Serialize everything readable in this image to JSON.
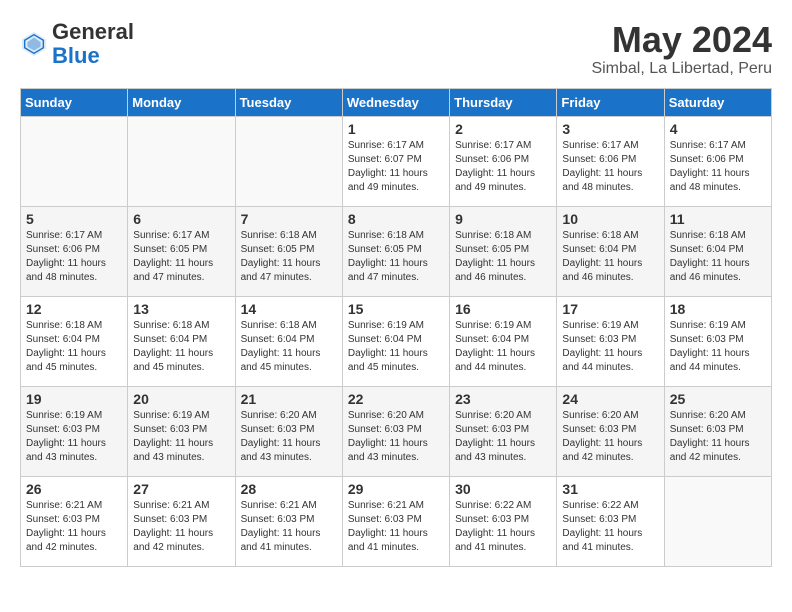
{
  "logo": {
    "general": "General",
    "blue": "Blue"
  },
  "title": {
    "month_year": "May 2024",
    "location": "Simbal, La Libertad, Peru"
  },
  "days_of_week": [
    "Sunday",
    "Monday",
    "Tuesday",
    "Wednesday",
    "Thursday",
    "Friday",
    "Saturday"
  ],
  "weeks": [
    [
      {
        "day": "",
        "info": ""
      },
      {
        "day": "",
        "info": ""
      },
      {
        "day": "",
        "info": ""
      },
      {
        "day": "1",
        "info": "Sunrise: 6:17 AM\nSunset: 6:07 PM\nDaylight: 11 hours\nand 49 minutes."
      },
      {
        "day": "2",
        "info": "Sunrise: 6:17 AM\nSunset: 6:06 PM\nDaylight: 11 hours\nand 49 minutes."
      },
      {
        "day": "3",
        "info": "Sunrise: 6:17 AM\nSunset: 6:06 PM\nDaylight: 11 hours\nand 48 minutes."
      },
      {
        "day": "4",
        "info": "Sunrise: 6:17 AM\nSunset: 6:06 PM\nDaylight: 11 hours\nand 48 minutes."
      }
    ],
    [
      {
        "day": "5",
        "info": "Sunrise: 6:17 AM\nSunset: 6:06 PM\nDaylight: 11 hours\nand 48 minutes."
      },
      {
        "day": "6",
        "info": "Sunrise: 6:17 AM\nSunset: 6:05 PM\nDaylight: 11 hours\nand 47 minutes."
      },
      {
        "day": "7",
        "info": "Sunrise: 6:18 AM\nSunset: 6:05 PM\nDaylight: 11 hours\nand 47 minutes."
      },
      {
        "day": "8",
        "info": "Sunrise: 6:18 AM\nSunset: 6:05 PM\nDaylight: 11 hours\nand 47 minutes."
      },
      {
        "day": "9",
        "info": "Sunrise: 6:18 AM\nSunset: 6:05 PM\nDaylight: 11 hours\nand 46 minutes."
      },
      {
        "day": "10",
        "info": "Sunrise: 6:18 AM\nSunset: 6:04 PM\nDaylight: 11 hours\nand 46 minutes."
      },
      {
        "day": "11",
        "info": "Sunrise: 6:18 AM\nSunset: 6:04 PM\nDaylight: 11 hours\nand 46 minutes."
      }
    ],
    [
      {
        "day": "12",
        "info": "Sunrise: 6:18 AM\nSunset: 6:04 PM\nDaylight: 11 hours\nand 45 minutes."
      },
      {
        "day": "13",
        "info": "Sunrise: 6:18 AM\nSunset: 6:04 PM\nDaylight: 11 hours\nand 45 minutes."
      },
      {
        "day": "14",
        "info": "Sunrise: 6:18 AM\nSunset: 6:04 PM\nDaylight: 11 hours\nand 45 minutes."
      },
      {
        "day": "15",
        "info": "Sunrise: 6:19 AM\nSunset: 6:04 PM\nDaylight: 11 hours\nand 45 minutes."
      },
      {
        "day": "16",
        "info": "Sunrise: 6:19 AM\nSunset: 6:04 PM\nDaylight: 11 hours\nand 44 minutes."
      },
      {
        "day": "17",
        "info": "Sunrise: 6:19 AM\nSunset: 6:03 PM\nDaylight: 11 hours\nand 44 minutes."
      },
      {
        "day": "18",
        "info": "Sunrise: 6:19 AM\nSunset: 6:03 PM\nDaylight: 11 hours\nand 44 minutes."
      }
    ],
    [
      {
        "day": "19",
        "info": "Sunrise: 6:19 AM\nSunset: 6:03 PM\nDaylight: 11 hours\nand 43 minutes."
      },
      {
        "day": "20",
        "info": "Sunrise: 6:19 AM\nSunset: 6:03 PM\nDaylight: 11 hours\nand 43 minutes."
      },
      {
        "day": "21",
        "info": "Sunrise: 6:20 AM\nSunset: 6:03 PM\nDaylight: 11 hours\nand 43 minutes."
      },
      {
        "day": "22",
        "info": "Sunrise: 6:20 AM\nSunset: 6:03 PM\nDaylight: 11 hours\nand 43 minutes."
      },
      {
        "day": "23",
        "info": "Sunrise: 6:20 AM\nSunset: 6:03 PM\nDaylight: 11 hours\nand 43 minutes."
      },
      {
        "day": "24",
        "info": "Sunrise: 6:20 AM\nSunset: 6:03 PM\nDaylight: 11 hours\nand 42 minutes."
      },
      {
        "day": "25",
        "info": "Sunrise: 6:20 AM\nSunset: 6:03 PM\nDaylight: 11 hours\nand 42 minutes."
      }
    ],
    [
      {
        "day": "26",
        "info": "Sunrise: 6:21 AM\nSunset: 6:03 PM\nDaylight: 11 hours\nand 42 minutes."
      },
      {
        "day": "27",
        "info": "Sunrise: 6:21 AM\nSunset: 6:03 PM\nDaylight: 11 hours\nand 42 minutes."
      },
      {
        "day": "28",
        "info": "Sunrise: 6:21 AM\nSunset: 6:03 PM\nDaylight: 11 hours\nand 41 minutes."
      },
      {
        "day": "29",
        "info": "Sunrise: 6:21 AM\nSunset: 6:03 PM\nDaylight: 11 hours\nand 41 minutes."
      },
      {
        "day": "30",
        "info": "Sunrise: 6:22 AM\nSunset: 6:03 PM\nDaylight: 11 hours\nand 41 minutes."
      },
      {
        "day": "31",
        "info": "Sunrise: 6:22 AM\nSunset: 6:03 PM\nDaylight: 11 hours\nand 41 minutes."
      },
      {
        "day": "",
        "info": ""
      }
    ]
  ]
}
